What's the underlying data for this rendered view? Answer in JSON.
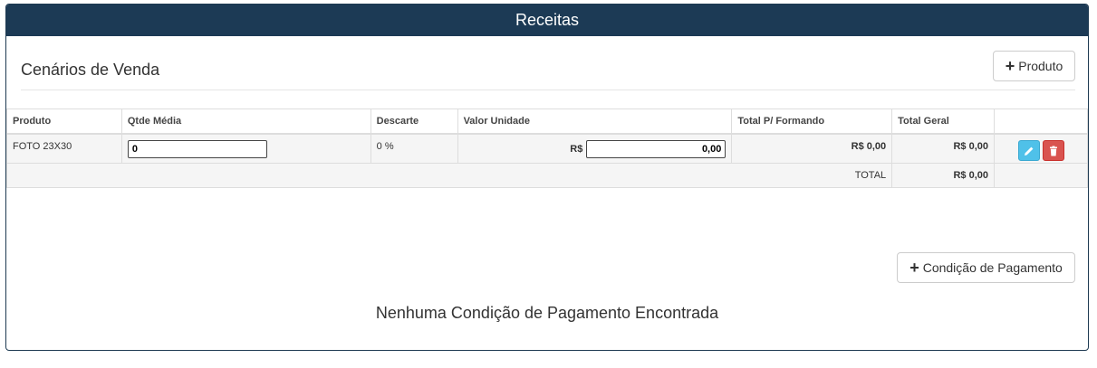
{
  "panel": {
    "title": "Receitas"
  },
  "section": {
    "title": "Cenários de Venda"
  },
  "buttons": {
    "produto": "Produto",
    "condicao": "Condição de Pagamento"
  },
  "table": {
    "headers": {
      "produto": "Produto",
      "qtde": "Qtde Média",
      "descarte": "Descarte",
      "valor": "Valor Unidade",
      "total_formando": "Total P/ Formando",
      "total_geral": "Total Geral"
    },
    "row": {
      "produto": "FOTO 23X30",
      "qtde": "0",
      "descarte": "0 %",
      "currency": "R$",
      "valor": "0,00",
      "total_formando": "R$ 0,00",
      "total_geral": "R$ 0,00"
    },
    "total": {
      "label": "TOTAL",
      "value": "R$ 0,00"
    }
  },
  "empty_message": "Nenhuma Condição de Pagamento Encontrada",
  "colors": {
    "header_bg": "#1c3a55",
    "edit": "#4fc1e9",
    "delete": "#d9534f"
  },
  "icons": {
    "add": "plus-icon",
    "edit": "pencil-icon",
    "delete": "trash-icon"
  }
}
